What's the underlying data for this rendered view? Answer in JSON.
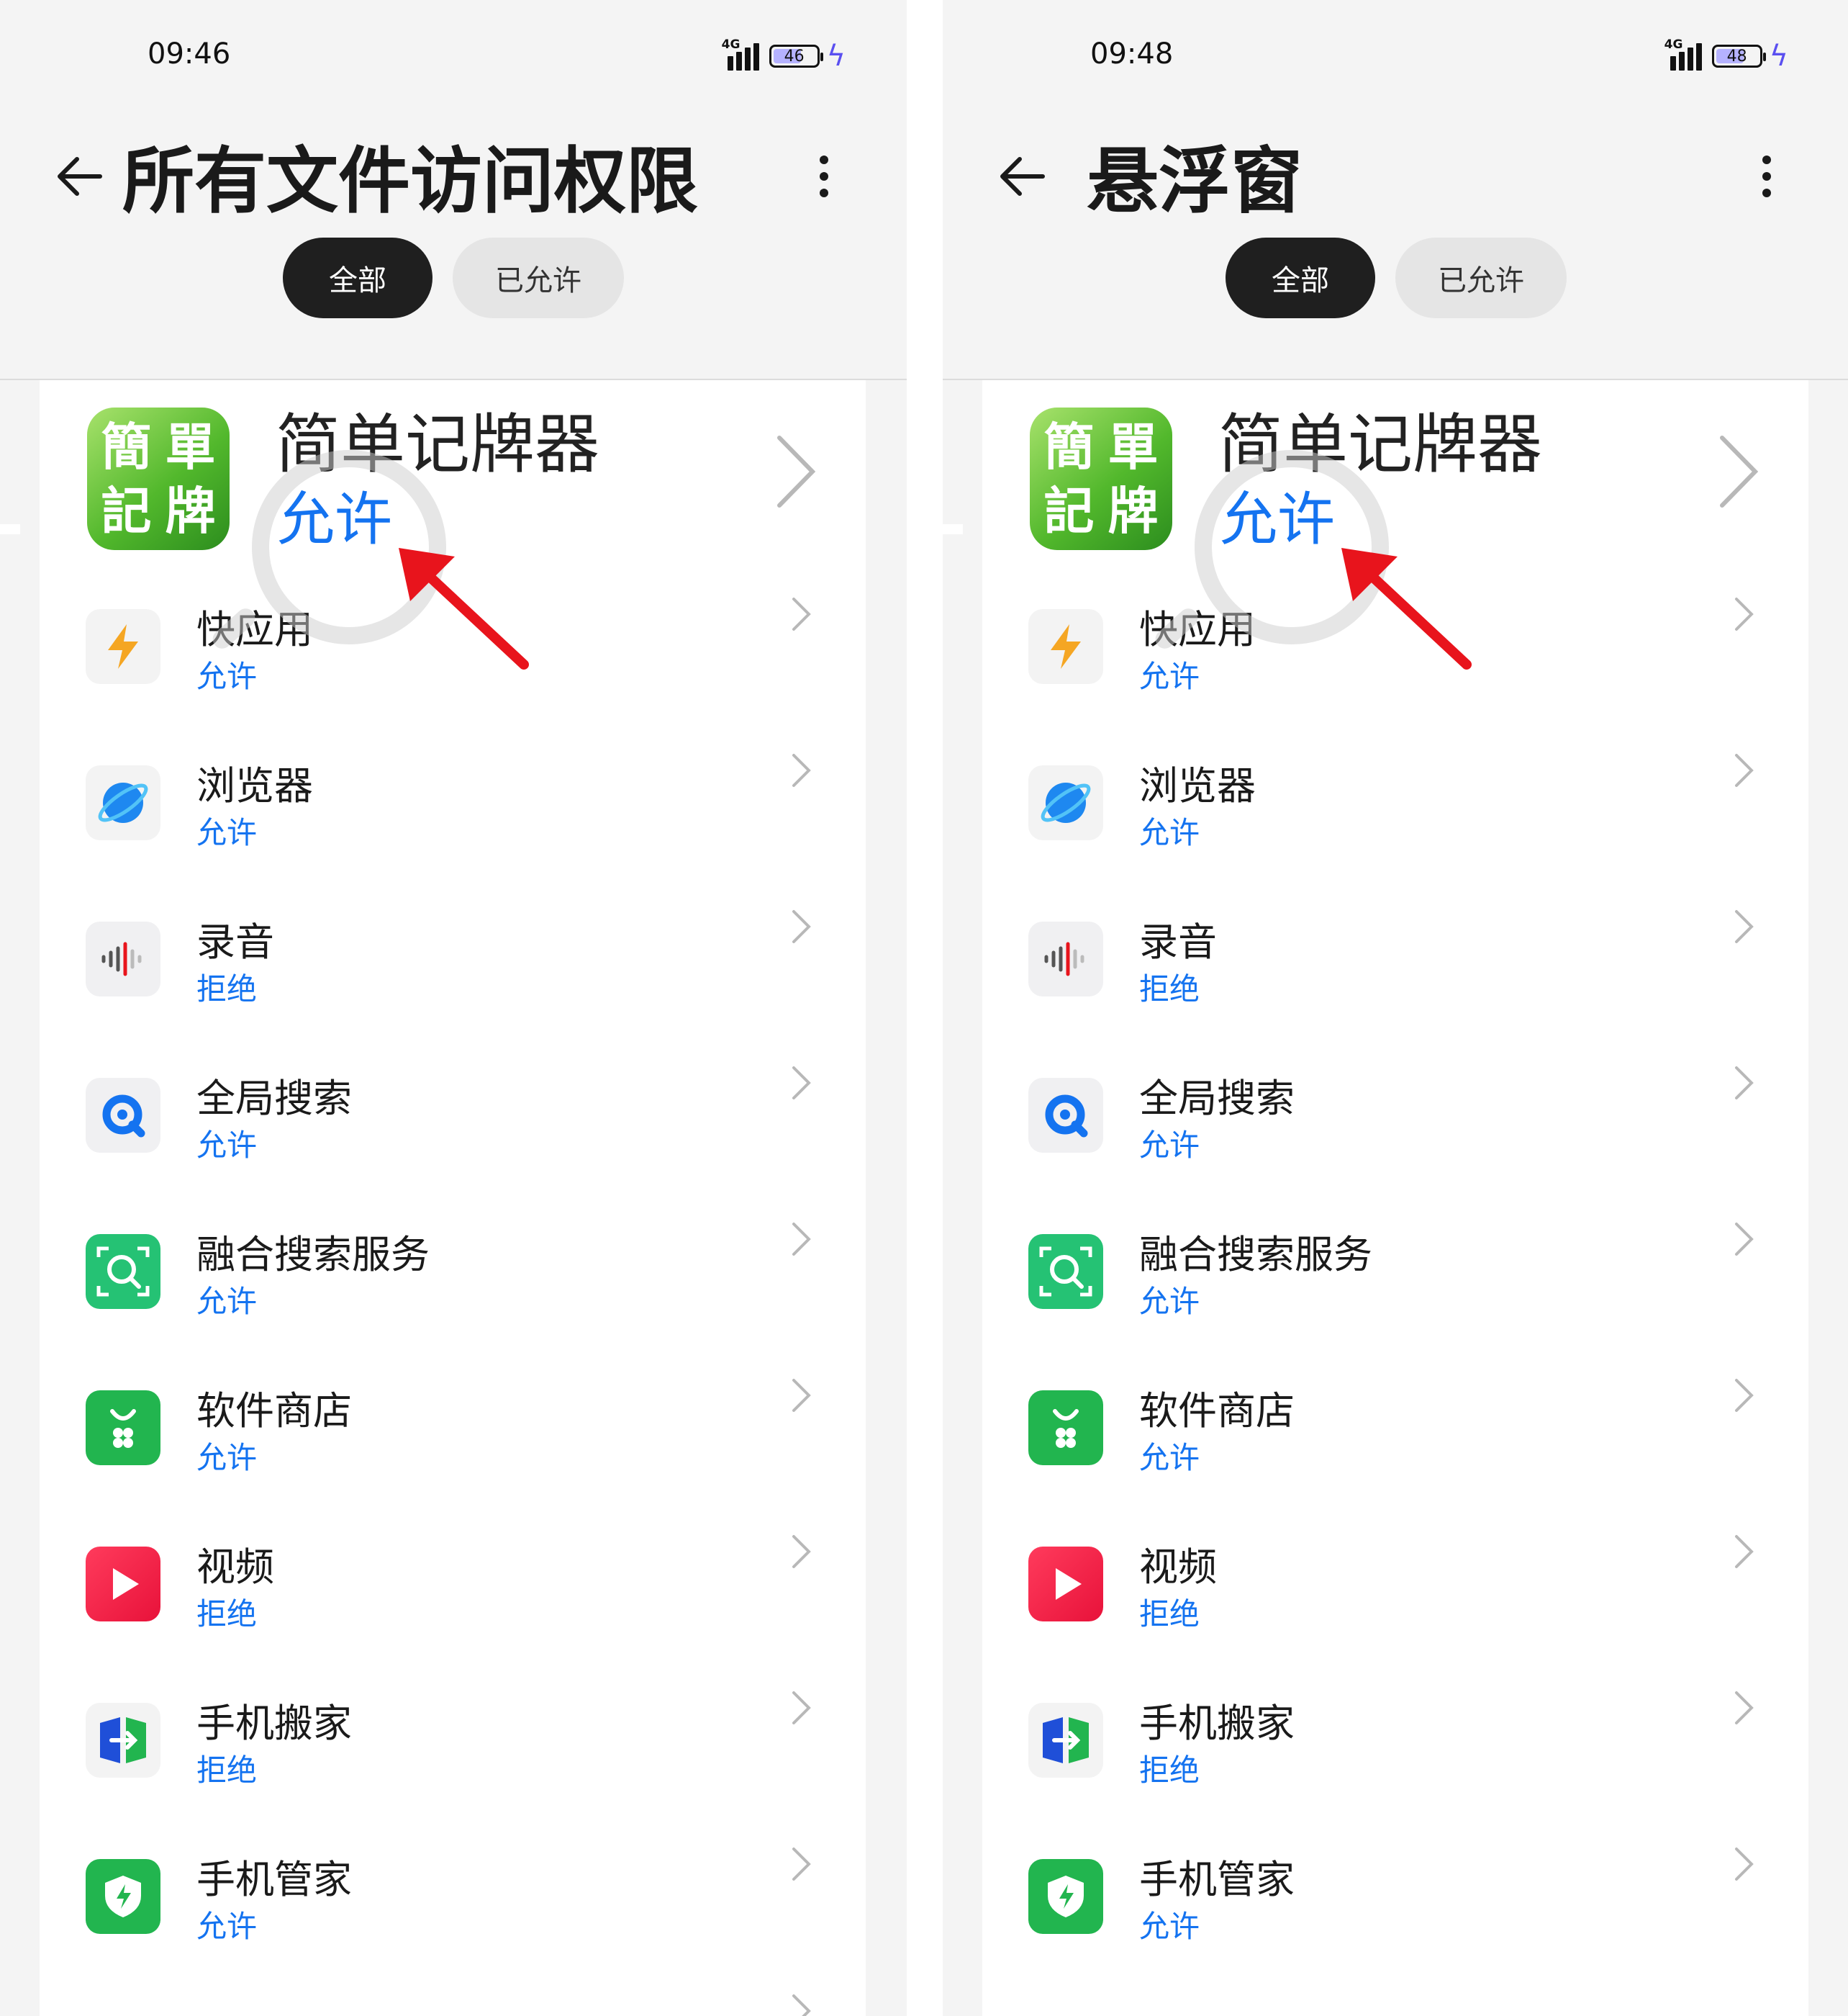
{
  "screens": [
    {
      "status_time": "09:46",
      "network_label": "4G",
      "battery_level": "46",
      "title": "所有文件访问权限",
      "tabs": [
        "全部",
        "已允许"
      ],
      "featured": {
        "name": "简单记牌器",
        "status": "允许"
      },
      "apps": [
        {
          "name": "快应用",
          "status": "允许",
          "icon": "quick-app-icon"
        },
        {
          "name": "浏览器",
          "status": "允许",
          "icon": "browser-icon"
        },
        {
          "name": "录音",
          "status": "拒绝",
          "icon": "recorder-icon"
        },
        {
          "name": "全局搜索",
          "status": "允许",
          "icon": "global-search-icon"
        },
        {
          "name": "融合搜索服务",
          "status": "允许",
          "icon": "fusion-search-icon"
        },
        {
          "name": "软件商店",
          "status": "允许",
          "icon": "app-store-icon"
        },
        {
          "name": "视频",
          "status": "拒绝",
          "icon": "video-icon"
        },
        {
          "name": "手机搬家",
          "status": "拒绝",
          "icon": "phone-clone-icon"
        },
        {
          "name": "手机管家",
          "status": "允许",
          "icon": "phone-manager-icon"
        }
      ]
    },
    {
      "status_time": "09:48",
      "network_label": "4G",
      "battery_level": "48",
      "title": "悬浮窗",
      "tabs": [
        "全部",
        "已允许"
      ],
      "featured": {
        "name": "简单记牌器",
        "status": "允许"
      },
      "apps": [
        {
          "name": "快应用",
          "status": "允许",
          "icon": "quick-app-icon"
        },
        {
          "name": "浏览器",
          "status": "允许",
          "icon": "browser-icon"
        },
        {
          "name": "录音",
          "status": "拒绝",
          "icon": "recorder-icon"
        },
        {
          "name": "全局搜索",
          "status": "允许",
          "icon": "global-search-icon"
        },
        {
          "name": "融合搜索服务",
          "status": "允许",
          "icon": "fusion-search-icon"
        },
        {
          "name": "软件商店",
          "status": "允许",
          "icon": "app-store-icon"
        },
        {
          "name": "视频",
          "status": "拒绝",
          "icon": "video-icon"
        },
        {
          "name": "手机搬家",
          "status": "拒绝",
          "icon": "phone-clone-icon"
        },
        {
          "name": "手机管家",
          "status": "允许",
          "icon": "phone-manager-icon"
        }
      ]
    }
  ],
  "app_logo_text": [
    "簡",
    "單",
    "記",
    "牌"
  ],
  "colors": {
    "accent_blue": "#1473f0",
    "annotation_red": "#e8141c",
    "dark_tab": "#1f1f1f"
  }
}
